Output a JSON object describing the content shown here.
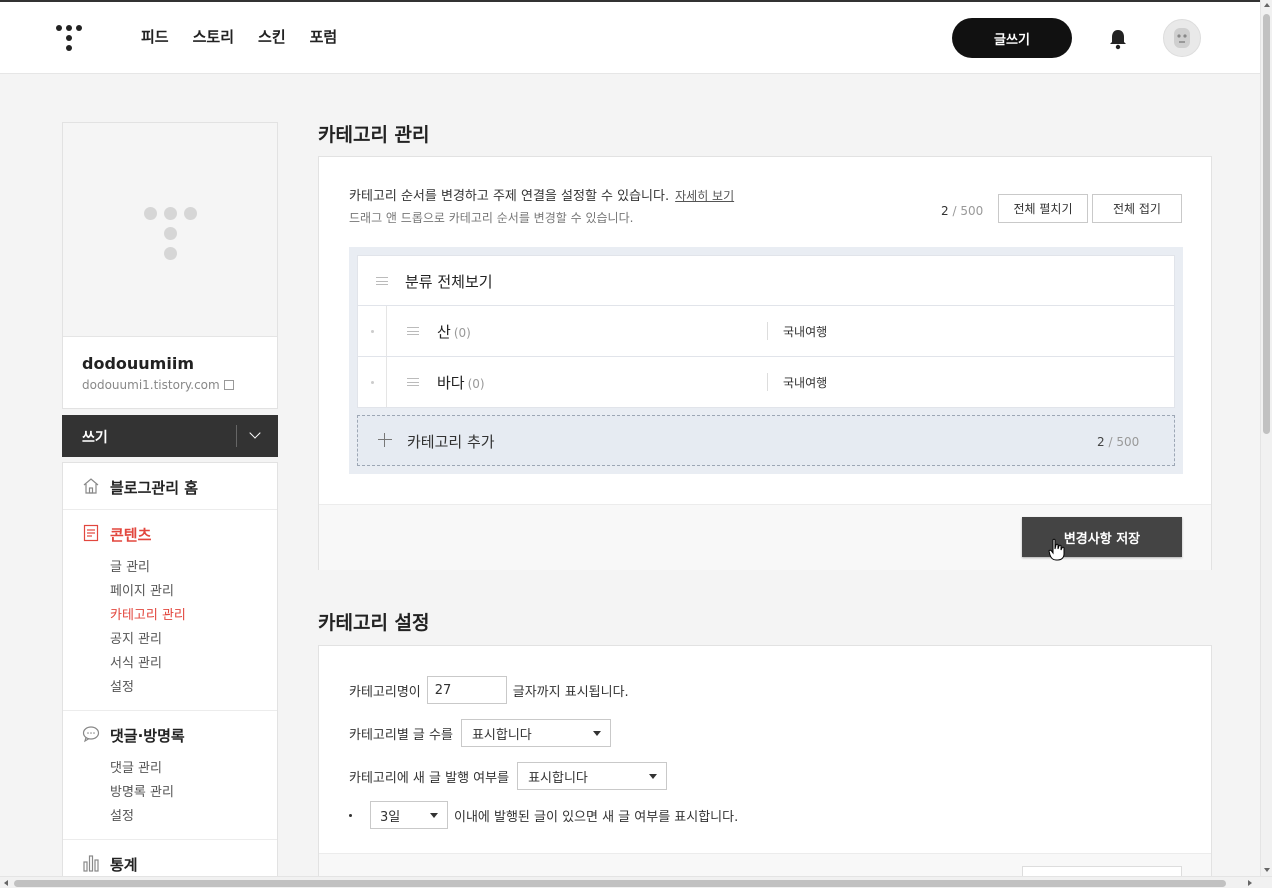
{
  "header": {
    "nav": [
      "피드",
      "스토리",
      "스킨",
      "포럼"
    ],
    "write_button": "글쓰기"
  },
  "profile": {
    "blog_name": "dodouumiim",
    "blog_url": "dodouumi1.tistory.com"
  },
  "write_bar": {
    "label": "쓰기"
  },
  "menu": {
    "home": "블로그관리 홈",
    "contents": {
      "title": "콘텐츠",
      "items": [
        "글 관리",
        "페이지 관리",
        "카테고리 관리",
        "공지 관리",
        "서식 관리",
        "설정"
      ]
    },
    "comments": {
      "title": "댓글·방명록",
      "items": [
        "댓글 관리",
        "방명록 관리",
        "설정"
      ]
    },
    "stats": {
      "title": "통계"
    }
  },
  "category_manage": {
    "title": "카테고리 관리",
    "description": "카테고리 순서를 변경하고 주제 연결을 설정할 수 있습니다.",
    "detail_link": "자세히 보기",
    "drag_hint": "드래그 앤 드롭으로 카테고리 순서를 변경할 수 있습니다.",
    "count": "2",
    "max": "/ 500",
    "expand_all": "전체 펼치기",
    "collapse_all": "전체 접기",
    "view_all": "분류 전체보기",
    "categories": [
      {
        "name": "산",
        "count": "(0)",
        "topic": "국내여행"
      },
      {
        "name": "바다",
        "count": "(0)",
        "topic": "국내여행"
      }
    ],
    "add_label": "카테고리 추가",
    "add_count": "2",
    "add_max": "/ 500",
    "save_button": "변경사항 저장"
  },
  "category_settings": {
    "title": "카테고리 설정",
    "name_length_prefix": "카테고리명이",
    "name_length_value": "27",
    "name_length_suffix": "글자까지 표시됩니다.",
    "post_count_label": "카테고리별 글 수를",
    "post_count_value": "표시합니다",
    "new_post_label": "카테고리에 새 글 발행 여부를",
    "new_post_value": "표시합니다",
    "days_value": "3일",
    "days_suffix": "이내에 발행된 글이 있으면 새 글 여부를 표시합니다."
  }
}
